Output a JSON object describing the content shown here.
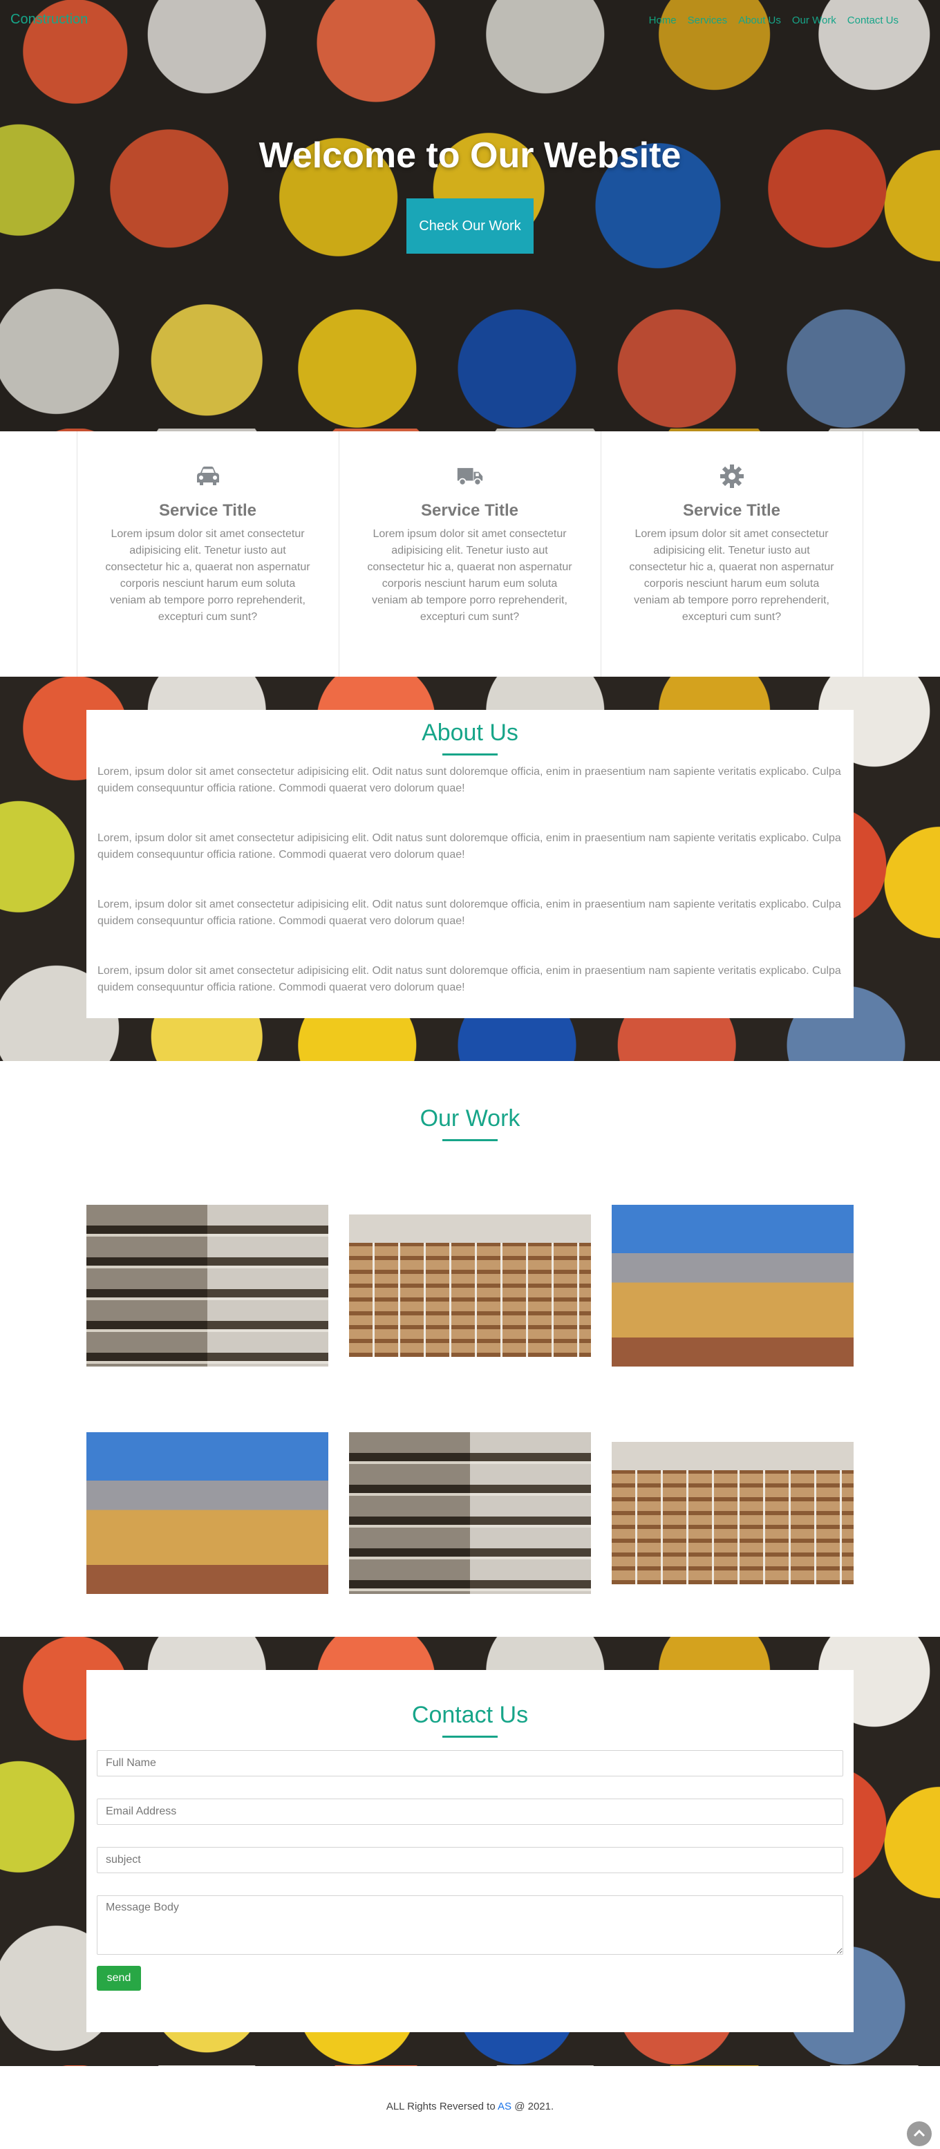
{
  "nav": {
    "brand": "Construction",
    "links": [
      "Home",
      "Services",
      "About Us",
      "Our Work",
      "Contact Us"
    ]
  },
  "hero": {
    "title": "Welcome to Our Website",
    "button": "Check Our Work"
  },
  "services": [
    {
      "icon": "car-icon",
      "title": "Service Title",
      "text": "Lorem ipsum dolor sit amet consectetur adipisicing elit. Tenetur iusto aut consectetur hic a, quaerat non aspernatur corporis nesciunt harum eum soluta veniam ab tempore porro reprehenderit, excepturi cum sunt?"
    },
    {
      "icon": "truck-icon",
      "title": "Service Title",
      "text": "Lorem ipsum dolor sit amet consectetur adipisicing elit. Tenetur iusto aut consectetur hic a, quaerat non aspernatur corporis nesciunt harum eum soluta veniam ab tempore porro reprehenderit, excepturi cum sunt?"
    },
    {
      "icon": "gear-icon",
      "title": "Service Title",
      "text": "Lorem ipsum dolor sit amet consectetur adipisicing elit. Tenetur iusto aut consectetur hic a, quaerat non aspernatur corporis nesciunt harum eum soluta veniam ab tempore porro reprehenderit, excepturi cum sunt?"
    }
  ],
  "about": {
    "title": "About Us",
    "paragraphs": [
      "Lorem, ipsum dolor sit amet consectetur adipisicing elit. Odit natus sunt doloremque officia, enim in praesentium nam sapiente veritatis explicabo. Culpa quidem consequuntur officia ratione. Commodi quaerat vero dolorum quae!",
      "Lorem, ipsum dolor sit amet consectetur adipisicing elit. Odit natus sunt doloremque officia, enim in praesentium nam sapiente veritatis explicabo. Culpa quidem consequuntur officia ratione. Commodi quaerat vero dolorum quae!",
      "Lorem, ipsum dolor sit amet consectetur adipisicing elit. Odit natus sunt doloremque officia, enim in praesentium nam sapiente veritatis explicabo. Culpa quidem consequuntur officia ratione. Commodi quaerat vero dolorum quae!",
      "Lorem, ipsum dolor sit amet consectetur adipisicing elit. Odit natus sunt doloremque officia, enim in praesentium nam sapiente veritatis explicabo. Culpa quidem consequuntur officia ratione. Commodi quaerat vero dolorum quae!"
    ]
  },
  "work": {
    "title": "Our Work",
    "images": [
      "building",
      "scaffold",
      "house",
      "house",
      "building",
      "scaffold"
    ]
  },
  "contact": {
    "title": "Contact Us",
    "full_name_placeholder": "Full Name",
    "email_placeholder": "Email Address",
    "subject_placeholder": "subject",
    "message_placeholder": "Message Body",
    "send_label": "send"
  },
  "footer": {
    "text_before": "ALL Rights Reversed to ",
    "link": "AS",
    "text_after": " @ 2021."
  },
  "colors": {
    "accent": "#17a589",
    "hero_button": "#1aa6b7",
    "send_button": "#28a745"
  }
}
